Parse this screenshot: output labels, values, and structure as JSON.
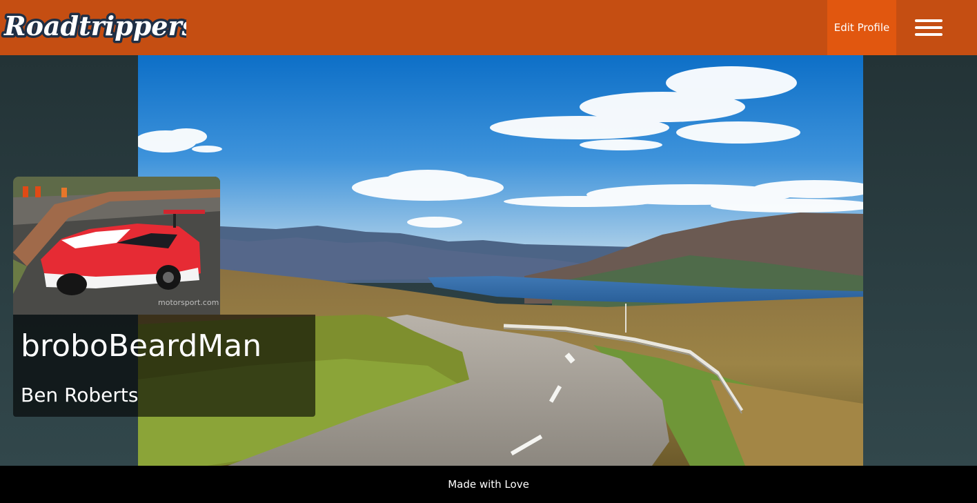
{
  "header": {
    "logo_text": "Roadtrippers",
    "edit_profile_label": "Edit Profile",
    "menu_icon": "hamburger-menu-icon"
  },
  "hero": {
    "image": "scenic-road-landscape"
  },
  "profile": {
    "avatar_image": "race-car-photo",
    "username": "broboBeardMan",
    "full_name": "Ben Roberts"
  },
  "footer": {
    "text": "Made with Love"
  },
  "colors": {
    "navbar": "#c54e12",
    "edit_button": "#e1570f",
    "page_background": "#213033",
    "footer": "#000000"
  }
}
